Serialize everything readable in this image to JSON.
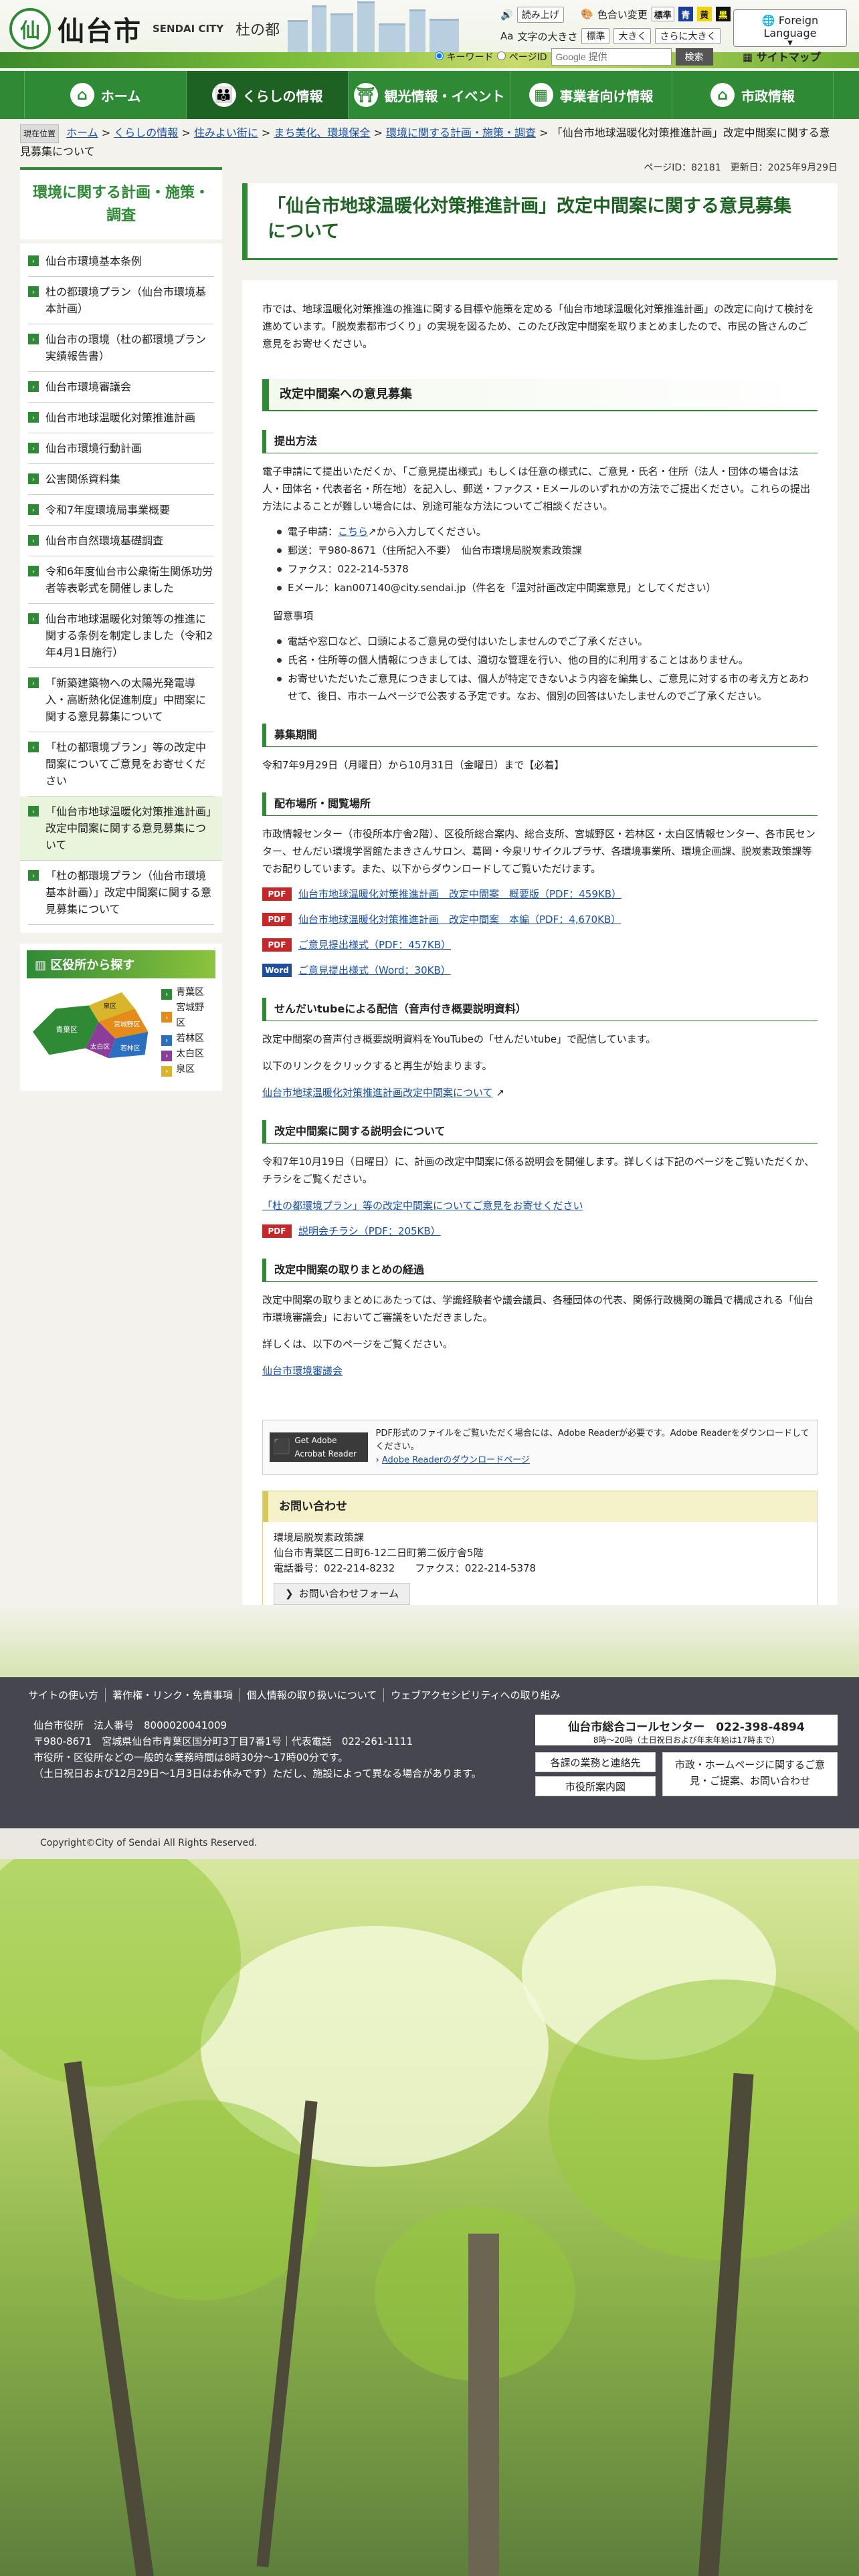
{
  "header": {
    "logo_mark": "仙",
    "city_name": "仙台市",
    "city_en": "SENDAI CITY",
    "tagline": "杜の都",
    "read_aloud": "読み上げ",
    "color_change": "色合い変更",
    "color_opts": [
      "標準",
      "青",
      "黄",
      "黒"
    ],
    "font_size_label": "文字の大きさ",
    "font_size_opts": [
      "標準",
      "大きく",
      "さらに大きく"
    ],
    "foreign": "Foreign Language",
    "search_opt1": "キーワード",
    "search_opt2": "ページID",
    "search_placeholder": "Google 提供",
    "search_btn": "検索",
    "sitemap": "サイトマップ"
  },
  "gnav": [
    {
      "label": "ホーム",
      "icon": "⌂"
    },
    {
      "label": "くらしの情報",
      "icon": "👪",
      "active": true
    },
    {
      "label": "観光情報・イベント",
      "icon": "⛩"
    },
    {
      "label": "事業者向け情報",
      "icon": "▦"
    },
    {
      "label": "市政情報",
      "icon": "⌂"
    }
  ],
  "breadcrumb": {
    "tag": "現在位置",
    "items": [
      "ホーム",
      "くらしの情報",
      "住みよい街に",
      "まち美化、環境保全",
      "環境に関する計画・施策・調査"
    ],
    "current": "「仙台市地球温暖化対策推進計画」改定中間案に関する意見募集について"
  },
  "sidebar": {
    "title": "環境に関する計画・施策・調査",
    "items": [
      {
        "label": "仙台市環境基本条例"
      },
      {
        "label": "杜の都環境プラン（仙台市環境基本計画）"
      },
      {
        "label": "仙台市の環境（杜の都環境プラン実績報告書）"
      },
      {
        "label": "仙台市環境審議会"
      },
      {
        "label": "仙台市地球温暖化対策推進計画"
      },
      {
        "label": "仙台市環境行動計画"
      },
      {
        "label": "公害関係資料集"
      },
      {
        "label": "令和7年度環境局事業概要"
      },
      {
        "label": "仙台市自然環境基礎調査"
      },
      {
        "label": "令和6年度仙台市公衆衛生関係功労者等表彰式を開催しました"
      },
      {
        "label": "仙台市地球温暖化対策等の推進に関する条例を制定しました（令和2年4月1日施行）"
      },
      {
        "label": "「新築建築物への太陽光発電導入・高断熱化促進制度」中間案に関する意見募集について"
      },
      {
        "label": "「杜の都環境プラン」等の改定中間案についてご意見をお寄せください"
      },
      {
        "label": "「仙台市地球温暖化対策推進計画」改定中間案に関する意見募集について",
        "active": true
      },
      {
        "label": "「杜の都環境プラン（仙台市環境基本計画）」改定中間案に関する意見募集について"
      }
    ],
    "ward_title": "区役所から探す",
    "wards": [
      "青葉区",
      "宮城野区",
      "若林区",
      "太白区",
      "泉区"
    ],
    "ward_colors": [
      "#2f8a36",
      "#e58b1a",
      "#2b6fc0",
      "#8a3e9a",
      "#d9b52b"
    ],
    "map_labels": [
      "青葉区",
      "泉区",
      "宮城野区",
      "太白区",
      "若林区"
    ]
  },
  "main": {
    "page_id": "ページID：82181",
    "updated": "更新日：2025年9月29日",
    "title": "「仙台市地球温暖化対策推進計画」改定中間案に関する意見募集について",
    "intro": "市では、地球温暖化対策推進の推進に関する目標や施策を定める「仙台市地球温暖化対策推進計画」の改定に向けて検討を進めています。「脱炭素都市づくり」の実現を図るため、このたび改定中間案を取りまとめましたので、市民の皆さんのご意見をお寄せください。",
    "h2": "改定中間案への意見募集",
    "h3_method": "提出方法",
    "method_text": "電子申請にて提出いただくか、「ご意見提出様式」もしくは任意の様式に、ご意見・氏名・住所（法人・団体の場合は法人・団体名・代表者名・所在地）を記入し、郵送・ファクス・Eメールのいずれかの方法でご提出ください。これらの提出方法によることが難しい場合には、別途可能な方法についてご相談ください。",
    "method_list": [
      {
        "pre": "電子申請：",
        "link": "こちら",
        "post": "から入力してください。"
      },
      {
        "pre": "郵送：〒980-8671（住所記入不要）　仙台市環境局脱炭素政策課",
        "link": "",
        "post": ""
      },
      {
        "pre": "ファクス：022-214-5378",
        "link": "",
        "post": ""
      },
      {
        "pre": "Eメール：kan007140@city.sendai.jp（件名を「温対計画改定中間案意見」としてください）",
        "link": "",
        "post": ""
      }
    ],
    "notes_head": "留意事項",
    "notes": [
      "電話や窓口など、口頭によるご意見の受付はいたしませんのでご了承ください。",
      "氏名・住所等の個人情報につきましては、適切な管理を行い、他の目的に利用することはありません。",
      "お寄せいただいたご意見につきましては、個人が特定できないよう内容を編集し、ご意見に対する市の考え方とあわせて、後日、市ホームページで公表する予定です。なお、個別の回答はいたしませんのでご了承ください。"
    ],
    "h3_period": "募集期間",
    "period": "令和7年9月29日（月曜日）から10月31日（金曜日）まで【必着】",
    "h3_dist": "配布場所・閲覧場所",
    "dist_text": "市政情報センター（市役所本庁舎2階）、区役所総合案内、総合支所、宮城野区・若林区・太白区情報センター、各市民センター、せんだい環境学習館たまきさんサロン、葛岡・今泉リサイクルプラザ、各環境事業所、環境企画課、脱炭素政策課等でお配りしています。また、以下からダウンロードしてご覧いただけます。",
    "files": [
      {
        "type": "PDF",
        "label": "仙台市地球温暖化対策推進計画　改定中間案　概要版（PDF：459KB）"
      },
      {
        "type": "PDF",
        "label": "仙台市地球温暖化対策推進計画　改定中間案　本編（PDF：4,670KB）"
      },
      {
        "type": "PDF",
        "label": "ご意見提出様式（PDF：457KB）"
      },
      {
        "type": "Word",
        "label": "ご意見提出様式（Word：30KB）"
      }
    ],
    "h3_tube": "せんだいtubeによる配信（音声付き概要説明資料）",
    "tube_text1": "改定中間案の音声付き概要説明資料をYouTubeの「せんだいtube」で配信しています。",
    "tube_text2": "以下のリンクをクリックすると再生が始まります。",
    "tube_link": "仙台市地球温暖化対策推進計画改定中間案について",
    "h3_brief": "改定中間案に関する説明会について",
    "brief_text": "令和7年10月19日（日曜日）に、計画の改定中間案に係る説明会を開催します。詳しくは下記のページをご覧いただくか、チラシをご覧ください。",
    "brief_link": "「杜の都環境プラン」等の改定中間案についてご意見をお寄せください",
    "brief_file": "説明会チラシ（PDF：205KB）",
    "h3_process": "改定中間案の取りまとめの経過",
    "process_text": "改定中間案の取りまとめにあたっては、学識経験者や議会議員、各種団体の代表、関係行政機関の職員で構成される「仙台市環境審議会」においてご審議をいただきました。",
    "process_text2": "詳しくは、以下のページをご覧ください。",
    "process_link": "仙台市環境審議会",
    "adobe_badge": "Get Adobe Acrobat Reader",
    "adobe_text": "PDF形式のファイルをご覧いただく場合には、Adobe Readerが必要です。Adobe Readerをダウンロードしてください。",
    "adobe_link": "Adobe Readerのダウンロードページ",
    "contact_head": "お問い合わせ",
    "contact_dept": "環境局脱炭素政策課",
    "contact_addr": "仙台市青葉区二日町6-12二日町第二仮庁舎5階",
    "contact_tel": "電話番号：022-214-8232　　ファクス：022-214-5378",
    "contact_btn": "お問い合わせフォーム"
  },
  "footer": {
    "links": [
      "サイトの使い方",
      "著作権・リンク・免責事項",
      "個人情報の取り扱いについて",
      "ウェブアクセシビリティへの取り組み"
    ],
    "org": "仙台市役所　法人番号　8000020041009",
    "addr": "〒980-8671　宮城県仙台市青葉区国分町3丁目7番1号｜代表電話　022-261-1111",
    "hours": "市役所・区役所などの一般的な業務時間は8時30分〜17時00分です。",
    "hours2": "（土日祝日および12月29日〜1月3日はお休みです）ただし、施設によって異なる場合があります。",
    "call_title": "仙台市総合コールセンター　022-398-4894",
    "call_sub": "8時〜20時（土日祝日および年末年始は17時まで）",
    "btn1": "各課の業務と連絡先",
    "btn2": "市役所案内図",
    "btn3": "市政・ホームページに関するご意見・ご提案、お問い合わせ",
    "copyright": "Copyright©City of Sendai All Rights Reserved."
  }
}
